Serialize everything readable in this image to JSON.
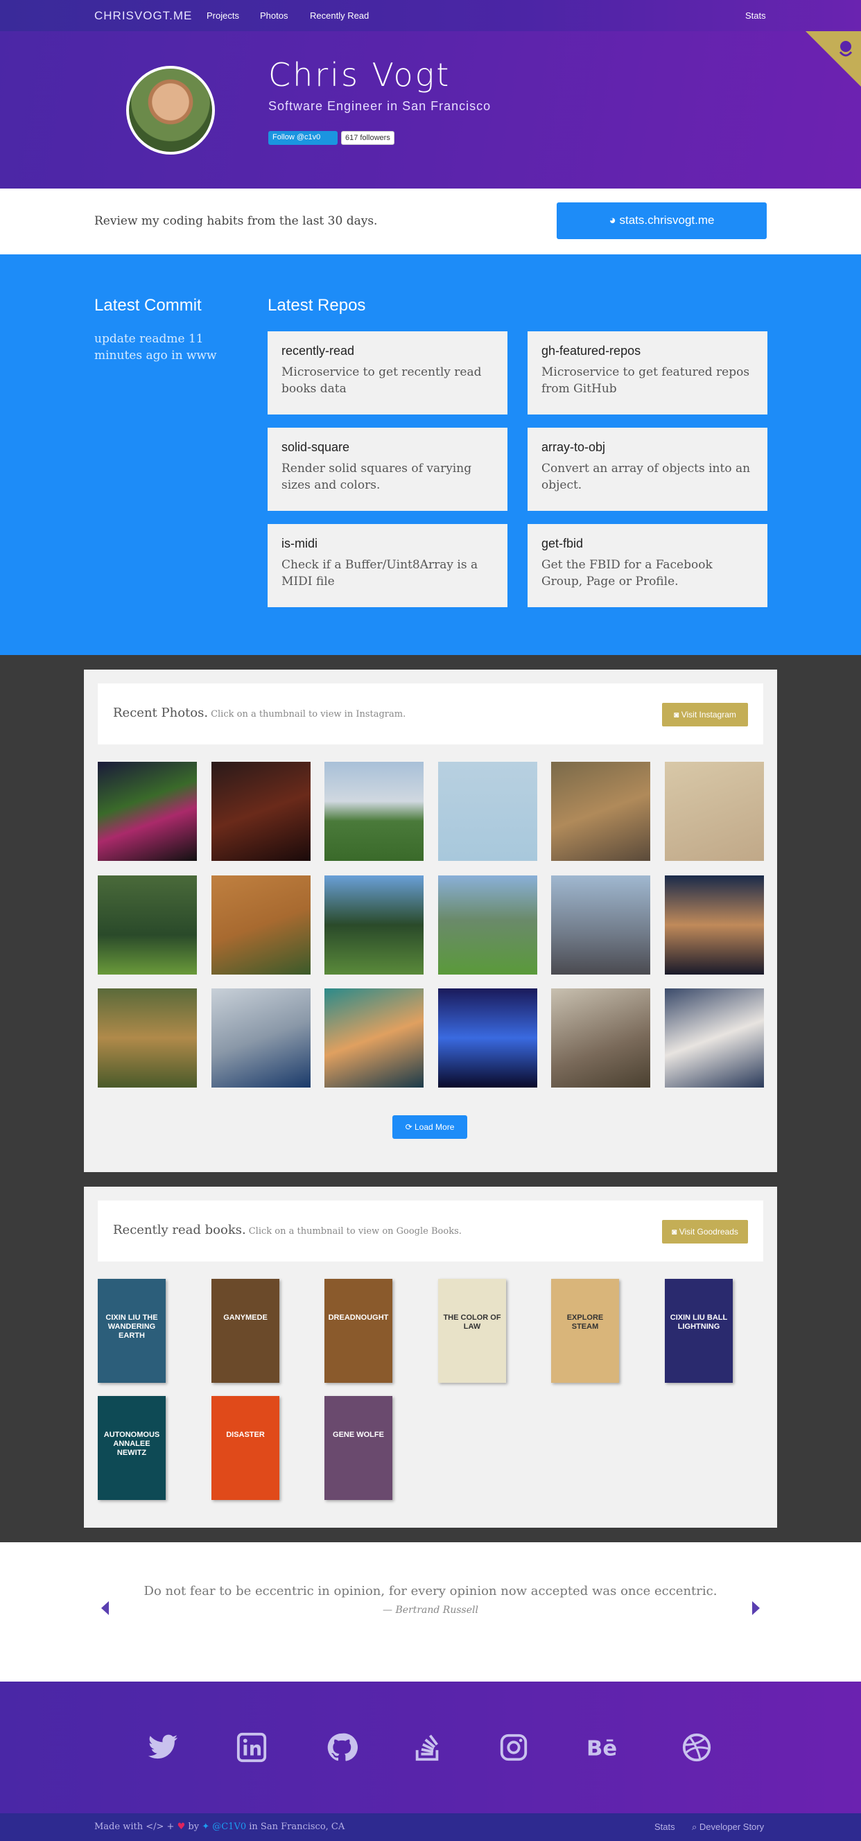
{
  "nav": {
    "brand": "CHRISVOGT.ME",
    "links": [
      "Projects",
      "Photos",
      "Recently Read"
    ],
    "right_link": "Stats"
  },
  "hero": {
    "name": "Chris Vogt",
    "tagline": "Software Engineer in San Francisco",
    "follow_label": "Follow @c1v0",
    "followers": "617 followers"
  },
  "stats": {
    "text": "Review my coding habits from the last 30 days.",
    "button": "stats.chrisvogt.me",
    "button_icon": "pie-chart-icon"
  },
  "commit": {
    "heading": "Latest Commit",
    "message": "update readme",
    "time": "11 minutes ago",
    "in_word": "in",
    "repo": "www"
  },
  "repos": {
    "heading": "Latest Repos",
    "items": [
      {
        "name": "recently-read",
        "desc": "Microservice to get recently read books data"
      },
      {
        "name": "gh-featured-repos",
        "desc": "Microservice to get featured repos from GitHub"
      },
      {
        "name": "solid-square",
        "desc": "Render solid squares of varying sizes and colors."
      },
      {
        "name": "array-to-obj",
        "desc": "Convert an array of objects into an object."
      },
      {
        "name": "is-midi",
        "desc": "Check if a Buffer/Uint8Array is a MIDI file"
      },
      {
        "name": "get-fbid",
        "desc": "Get the FBID for a Facebook Group, Page or Profile."
      }
    ]
  },
  "photos": {
    "title": "Recent Photos.",
    "subtitle": "Click on a thumbnail to view in Instagram.",
    "button": "Visit Instagram",
    "load_more": "Load More"
  },
  "books": {
    "title": "Recently read books.",
    "subtitle": "Click on a thumbnail to view on Google Books.",
    "button": "Visit Goodreads",
    "covers": [
      {
        "title": "CIXIN LIU THE WANDERING EARTH",
        "color": "#2c5e7a"
      },
      {
        "title": "GANYMEDE",
        "color": "#6b4a2a"
      },
      {
        "title": "DREADNOUGHT",
        "color": "#8a5a2c"
      },
      {
        "title": "THE COLOR OF LAW",
        "color": "#e8e2c8"
      },
      {
        "title": "EXPLORE STEAM",
        "color": "#d9b57a"
      },
      {
        "title": "CIXIN LIU BALL LIGHTNING",
        "color": "#2a2a6e"
      },
      {
        "title": "AUTONOMOUS ANNALEE NEWITZ",
        "color": "#0e4a55"
      },
      {
        "title": "DISASTER",
        "color": "#e04a1a"
      },
      {
        "title": "GENE WOLFE",
        "color": "#6a4a6e"
      }
    ]
  },
  "quote": {
    "text": "Do not fear to be eccentric in opinion, for every opinion now accepted was once eccentric.",
    "author": "— Bertrand Russell"
  },
  "footer": {
    "made_with": "Made with",
    "by": "by",
    "handle": "@C1V0",
    "location": "in San Francisco, CA",
    "right_links": [
      "Stats",
      "Developer Story"
    ],
    "socials": [
      "twitter-icon",
      "linkedin-icon",
      "github-icon",
      "stackoverflow-icon",
      "instagram-icon",
      "behance-icon",
      "dribbble-icon"
    ]
  },
  "colors": {
    "accent_blue": "#1d8cf8",
    "gold": "#c4ae56",
    "purple": "#5a24ab"
  }
}
